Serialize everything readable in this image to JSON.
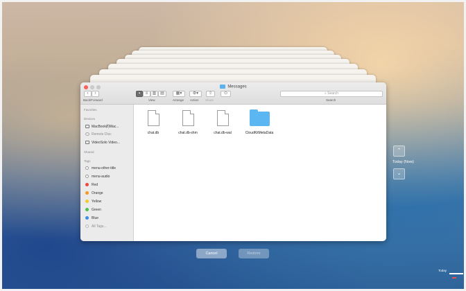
{
  "window": {
    "title": "Messages",
    "toolbar": {
      "back_forward_label": "Back/Forward",
      "view_label": "View",
      "arrange_label": "Arrange",
      "action_label": "Action",
      "share_label": "Share",
      "search_label": "Search",
      "search_placeholder": "Search"
    }
  },
  "sidebar": {
    "favorites_header": "Favorites",
    "devices_header": "Devices",
    "devices": [
      "MacBook的Mac...",
      "Remote Disc",
      "VideoSolo Video..."
    ],
    "shared_header": "Shared",
    "tags_header": "Tags",
    "tags": [
      {
        "label": "menu-other-title",
        "color": "#ffffff"
      },
      {
        "label": "menu-audio",
        "color": "#ffffff"
      },
      {
        "label": "Red",
        "color": "#f0473e"
      },
      {
        "label": "Orange",
        "color": "#f59a23"
      },
      {
        "label": "Yellow",
        "color": "#f5cb2b"
      },
      {
        "label": "Green",
        "color": "#4bc34b"
      },
      {
        "label": "Blue",
        "color": "#3d8ee8"
      },
      {
        "label": "All Tags...",
        "color": ""
      }
    ]
  },
  "files": [
    {
      "name": "chat.db",
      "kind": "document"
    },
    {
      "name": "chat.db-shm",
      "kind": "document"
    },
    {
      "name": "chat.db-wal",
      "kind": "document"
    },
    {
      "name": "CloudKitMetaData",
      "kind": "folder"
    }
  ],
  "timemachine": {
    "now_label": "Today (Now)",
    "timeline_label": "Today"
  },
  "footer": {
    "cancel_label": "Cancel",
    "restore_label": "Restore"
  }
}
